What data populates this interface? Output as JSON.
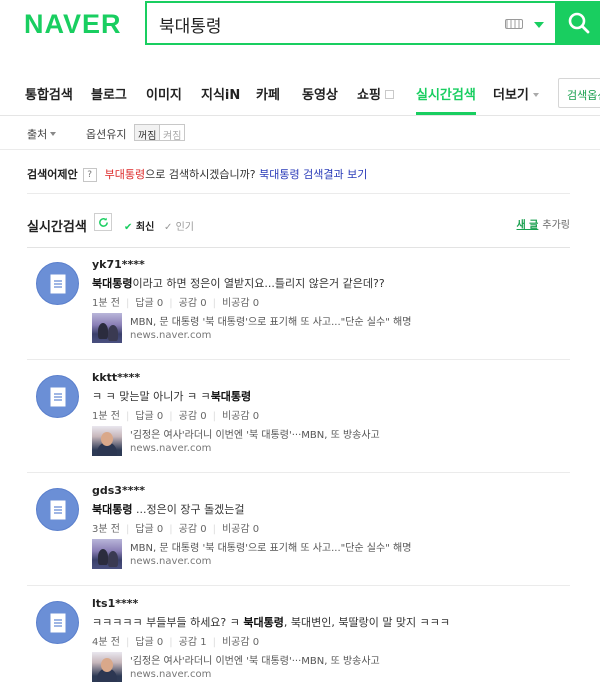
{
  "logo": "NAVER",
  "search": {
    "value": "북대통령"
  },
  "tabs": [
    {
      "label": "통합검색"
    },
    {
      "label": "블로그"
    },
    {
      "label": "이미지"
    },
    {
      "label": "지식iN"
    },
    {
      "label": "카페"
    },
    {
      "label": "동영상"
    },
    {
      "label": "쇼핑"
    },
    {
      "label": "실시간검색"
    },
    {
      "label": "더보기"
    }
  ],
  "search_options_button": "검색옵션",
  "options": {
    "source": "출처",
    "keep": "옵션유지",
    "on": "꺼짐",
    "off": "켜짐"
  },
  "suggestion": {
    "label": "검색어제안",
    "help": "?",
    "term": "부대통령",
    "middle": "으로 검색하시겠습니까?",
    "alt_term": "북대통령",
    "tail": "검색결과 보기"
  },
  "realtime": {
    "title": "실시간검색",
    "sort_latest": "최신",
    "sort_popular": "인기",
    "new_label": "새 글",
    "hide_label": "추가링"
  },
  "posts": [
    {
      "user": "yk71****",
      "keyword": "북대통령",
      "text": "이라고 하면 정은이 열받지요...틀리지 않은거 같은데??",
      "time": "1분 전",
      "replies": "답글 0",
      "likes": "공감 0",
      "dislikes": "비공감 0",
      "news_title": "MBN, 문 대통령 '북 대통령'으로 표기해 또 사고...\"단순 실수\" 해명",
      "news_source": "news.naver.com"
    },
    {
      "user": "kktt****",
      "prefix": "ㅋ ㅋ 맞는말 아니가 ㅋ ㅋ",
      "keyword": "북대통령",
      "time": "1분 전",
      "replies": "답글 0",
      "likes": "공감 0",
      "dislikes": "비공감 0",
      "news_title": "'김정은 여사'라더니 이번엔 '북 대통령'···MBN, 또 방송사고",
      "news_source": "news.naver.com"
    },
    {
      "user": "gds3****",
      "keyword": "북대통령",
      "text": " ...정은이 장구 돌겠는걸",
      "time": "3분 전",
      "replies": "답글 0",
      "likes": "공감 0",
      "dislikes": "비공감 0",
      "news_title": "MBN, 문 대통령 '북 대통령'으로 표기해 또 사고...\"단순 실수\" 해명",
      "news_source": "news.naver.com"
    },
    {
      "user": "lts1****",
      "prefix": "ㅋㅋㅋㅋㅋ 부들부들 하세요? ㅋ",
      "keyword": "북대통령",
      "text": ", 북대변인, 북딸랑이 말 맞지 ㅋㅋㅋ",
      "time": "4분 전",
      "replies": "답글 0",
      "likes": "공감 1",
      "dislikes": "비공감 0",
      "news_title": "'김정은 여사'라더니 이번엔 '북 대통령'···MBN, 또 방송사고",
      "news_source": "news.naver.com"
    }
  ],
  "colors": {
    "brand_green": "#19ce60",
    "suggest_red": "#dd2828",
    "suggest_blue": "#2a3bb8",
    "avatar_blue": "#6b8fd6"
  },
  "icons": [
    "search-icon",
    "keyboard-icon",
    "refresh-icon",
    "check-icon",
    "note-icon"
  ]
}
